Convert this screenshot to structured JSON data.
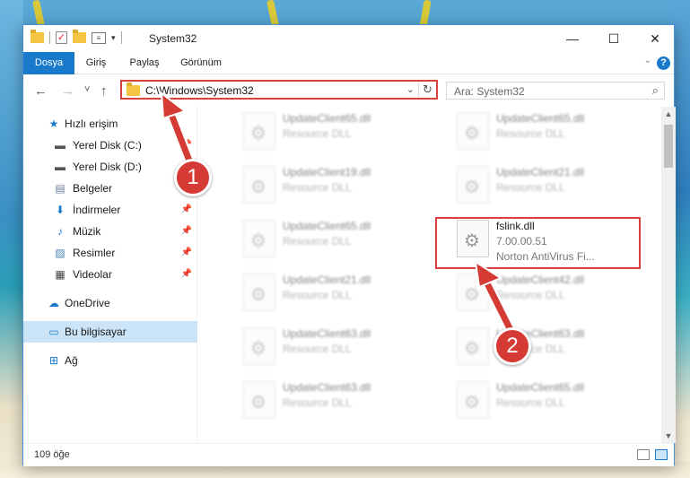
{
  "window": {
    "title": "System32",
    "controls": {
      "minimize": "—",
      "maximize": "☐",
      "close": "✕"
    }
  },
  "ribbon": {
    "tabs": [
      "Dosya",
      "Giriş",
      "Paylaş",
      "Görünüm"
    ],
    "help": "?"
  },
  "navigation": {
    "back": "←",
    "forward": "→",
    "recent": "˅",
    "up": "↑",
    "address": "C:\\Windows\\System32",
    "refresh": "↻",
    "search_placeholder": "Ara: System32"
  },
  "sidebar": {
    "items": [
      {
        "label": "Hızlı erişim",
        "icon": "star-icon"
      },
      {
        "label": "Yerel Disk (C:)",
        "icon": "drive-icon",
        "pinned": true
      },
      {
        "label": "Yerel Disk (D:)",
        "icon": "drive-icon"
      },
      {
        "label": "Belgeler",
        "icon": "documents-icon"
      },
      {
        "label": "İndirmeler",
        "icon": "download-icon",
        "pinned": true
      },
      {
        "label": "Müzik",
        "icon": "music-icon",
        "pinned": true
      },
      {
        "label": "Resimler",
        "icon": "pictures-icon",
        "pinned": true
      },
      {
        "label": "Videolar",
        "icon": "videos-icon",
        "pinned": true
      },
      {
        "label": "OneDrive",
        "icon": "cloud-icon"
      },
      {
        "label": "Bu bilgisayar",
        "icon": "computer-icon",
        "selected": true
      },
      {
        "label": "Ağ",
        "icon": "network-icon"
      }
    ]
  },
  "files": [
    {
      "name": "UpdateClient65.dll",
      "line2": "Resource DLL",
      "line3": "",
      "blurred": true
    },
    {
      "name": "UpdateClient65.dll",
      "line2": "Resource DLL",
      "line3": "",
      "blurred": true
    },
    {
      "name": "UpdateClient19.dll",
      "line2": "Resource DLL",
      "line3": "",
      "blurred": true
    },
    {
      "name": "UpdateClient21.dll",
      "line2": "Resource DLL",
      "line3": "",
      "blurred": true
    },
    {
      "name": "UpdateClient65.dll",
      "line2": "Resource DLL",
      "line3": "",
      "blurred": true
    },
    {
      "name": "fslink.dll",
      "line2": "7.00.00.51",
      "line3": "Norton AntiVirus Fi...",
      "blurred": false
    },
    {
      "name": "UpdateClient21.dll",
      "line2": "Resource DLL",
      "line3": "",
      "blurred": true
    },
    {
      "name": "UpdateClient42.dll",
      "line2": "Resource DLL",
      "line3": "",
      "blurred": true
    },
    {
      "name": "UpdateClient63.dll",
      "line2": "Resource DLL",
      "line3": "",
      "blurred": true
    },
    {
      "name": "UpdateClient63.dll",
      "line2": "Resource DLL",
      "line3": "",
      "blurred": true
    },
    {
      "name": "UpdateClient63.dll",
      "line2": "Resource DLL",
      "line3": "",
      "blurred": true
    },
    {
      "name": "UpdateClient65.dll",
      "line2": "Resource DLL",
      "line3": "",
      "blurred": true
    }
  ],
  "status": {
    "count": "109 öğe"
  },
  "callouts": {
    "step1": "1",
    "step2": "2"
  },
  "colors": {
    "accent": "#1979ca",
    "highlight": "#d9413c",
    "selected": "#cce4f7"
  }
}
